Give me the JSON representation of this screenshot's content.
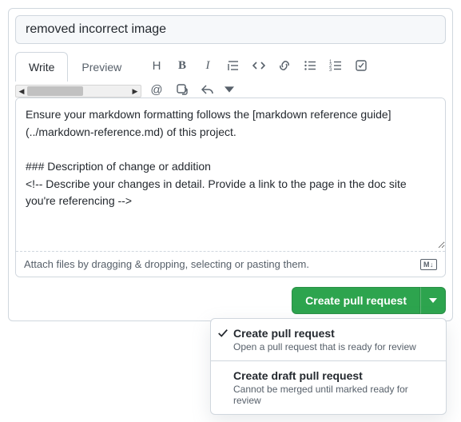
{
  "title_value": "removed incorrect image",
  "tabs": {
    "write": "Write",
    "preview": "Preview"
  },
  "comment_value": "Ensure your markdown formatting follows the [markdown reference guide](../markdown-reference.md) of this project.\n\n### Description of change or addition\n<!-- Describe your changes in detail. Provide a link to the page in the doc site you're referencing -->",
  "attach_hint": "Attach files by dragging & dropping, selecting or pasting them.",
  "md_badge": "M↓",
  "submit_label": "Create pull request",
  "dropdown": [
    {
      "title": "Create pull request",
      "desc": "Open a pull request that is ready for review",
      "checked": true
    },
    {
      "title": "Create draft pull request",
      "desc": "Cannot be merged until marked ready for review",
      "checked": false
    }
  ],
  "toolbar_glyphs": {
    "heading": "H",
    "bold": "B",
    "italic": "I",
    "at": "@"
  }
}
